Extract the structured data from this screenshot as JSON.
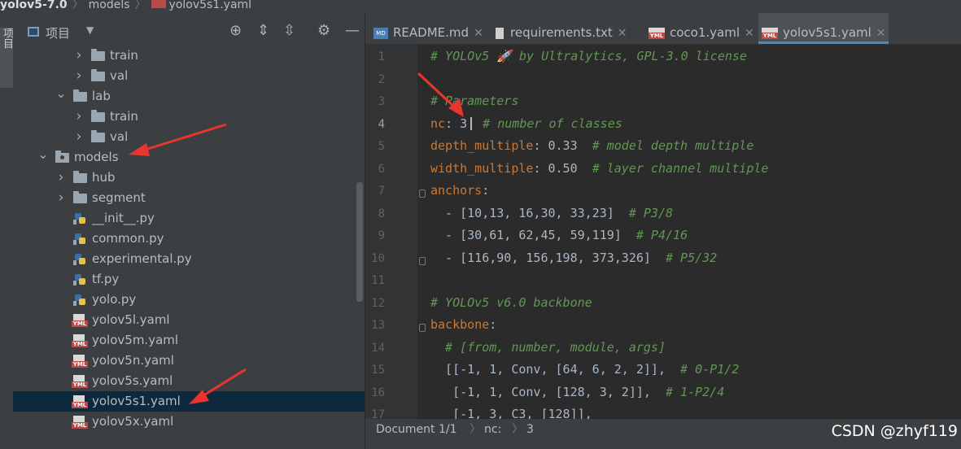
{
  "breadcrumb": {
    "project": "yolov5-7.0",
    "folder": "models",
    "file": "yolov5s1.yaml"
  },
  "left_strip": {
    "tab_label": "项目"
  },
  "project_panel": {
    "title": "项目",
    "tools": [
      "locate-icon",
      "expand-all-icon",
      "collapse-all-icon",
      "settings-icon",
      "hide-icon"
    ],
    "tree": [
      {
        "label": "train",
        "type": "folder",
        "depth": 3,
        "expanded": false
      },
      {
        "label": "val",
        "type": "folder",
        "depth": 3,
        "expanded": false
      },
      {
        "label": "lab",
        "type": "folder",
        "depth": 2,
        "expanded": true
      },
      {
        "label": "train",
        "type": "folder",
        "depth": 3,
        "expanded": false
      },
      {
        "label": "val",
        "type": "folder",
        "depth": 3,
        "expanded": false
      },
      {
        "label": "models",
        "type": "package",
        "depth": 1,
        "expanded": true
      },
      {
        "label": "hub",
        "type": "folder",
        "depth": 2,
        "expanded": false
      },
      {
        "label": "segment",
        "type": "folder",
        "depth": 2,
        "expanded": false
      },
      {
        "label": "__init__.py",
        "type": "py",
        "depth": 2
      },
      {
        "label": "common.py",
        "type": "py",
        "depth": 2
      },
      {
        "label": "experimental.py",
        "type": "py",
        "depth": 2
      },
      {
        "label": "tf.py",
        "type": "py",
        "depth": 2
      },
      {
        "label": "yolo.py",
        "type": "py",
        "depth": 2
      },
      {
        "label": "yolov5l.yaml",
        "type": "yml",
        "depth": 2
      },
      {
        "label": "yolov5m.yaml",
        "type": "yml",
        "depth": 2
      },
      {
        "label": "yolov5n.yaml",
        "type": "yml",
        "depth": 2
      },
      {
        "label": "yolov5s.yaml",
        "type": "yml",
        "depth": 2
      },
      {
        "label": "yolov5s1.yaml",
        "type": "yml",
        "depth": 2,
        "selected": true
      },
      {
        "label": "yolov5x.yaml",
        "type": "yml",
        "depth": 2
      }
    ]
  },
  "tabs": [
    {
      "label": "README.md",
      "icon": "md"
    },
    {
      "label": "requirements.txt",
      "icon": "txt"
    },
    {
      "label": "coco1.yaml",
      "icon": "yml"
    },
    {
      "label": "yolov5s1.yaml",
      "icon": "yml",
      "active": true
    }
  ],
  "code_lines": [
    {
      "n": "1",
      "parts": [
        [
          "cm",
          "# YOLOv5 🚀 by Ultralytics, GPL-3.0 license"
        ]
      ]
    },
    {
      "n": "2",
      "parts": []
    },
    {
      "n": "3",
      "parts": [
        [
          "cm",
          "# Parameters"
        ]
      ]
    },
    {
      "n": "4",
      "current": true,
      "parts": [
        [
          "key",
          "nc"
        ],
        [
          "val",
          ": 3"
        ],
        [
          "caret",
          ""
        ],
        [
          "cm",
          " # number of classes"
        ]
      ]
    },
    {
      "n": "5",
      "parts": [
        [
          "key",
          "depth_multiple"
        ],
        [
          "val",
          ": 0.33  "
        ],
        [
          "cm",
          "# model depth multiple"
        ]
      ]
    },
    {
      "n": "6",
      "parts": [
        [
          "key",
          "width_multiple"
        ],
        [
          "val",
          ": 0.50  "
        ],
        [
          "cm",
          "# layer channel multiple"
        ]
      ]
    },
    {
      "n": "7",
      "fold": true,
      "parts": [
        [
          "key",
          "anchors"
        ],
        [
          "val",
          ":"
        ]
      ]
    },
    {
      "n": "8",
      "parts": [
        [
          "val",
          "  - [10,13, 16,30, 33,23]  "
        ],
        [
          "cm",
          "# P3/8"
        ]
      ]
    },
    {
      "n": "9",
      "parts": [
        [
          "val",
          "  - [30,61, 62,45, 59,119]  "
        ],
        [
          "cm",
          "# P4/16"
        ]
      ]
    },
    {
      "n": "10",
      "fold": true,
      "parts": [
        [
          "val",
          "  - [116,90, 156,198, 373,326]  "
        ],
        [
          "cm",
          "# P5/32"
        ]
      ]
    },
    {
      "n": "11",
      "parts": []
    },
    {
      "n": "12",
      "parts": [
        [
          "cm",
          "# YOLOv5 v6.0 backbone"
        ]
      ]
    },
    {
      "n": "13",
      "fold": true,
      "parts": [
        [
          "key",
          "backbone"
        ],
        [
          "val",
          ":"
        ]
      ]
    },
    {
      "n": "14",
      "parts": [
        [
          "cm",
          "  # [from, number, module, args]"
        ]
      ]
    },
    {
      "n": "15",
      "parts": [
        [
          "val",
          "  [[-1, 1, Conv, [64, 6, 2, 2]],  "
        ],
        [
          "cm",
          "# 0-P1/2"
        ]
      ]
    },
    {
      "n": "16",
      "parts": [
        [
          "val",
          "   [-1, 1, Conv, [128, 3, 2]],  "
        ],
        [
          "cm",
          "# 1-P2/4"
        ]
      ]
    },
    {
      "n": "17",
      "parts": [
        [
          "val",
          "   [-1, 3, C3, [128]],"
        ]
      ]
    }
  ],
  "statusbar": {
    "doc": "Document 1/1",
    "key": "nc:",
    "value": "3"
  },
  "watermark": "CSDN @zhyf119",
  "colors": {
    "accent": "#4a88c7",
    "annotation_arrow": "#e8352d",
    "selection": "#0d293e"
  }
}
